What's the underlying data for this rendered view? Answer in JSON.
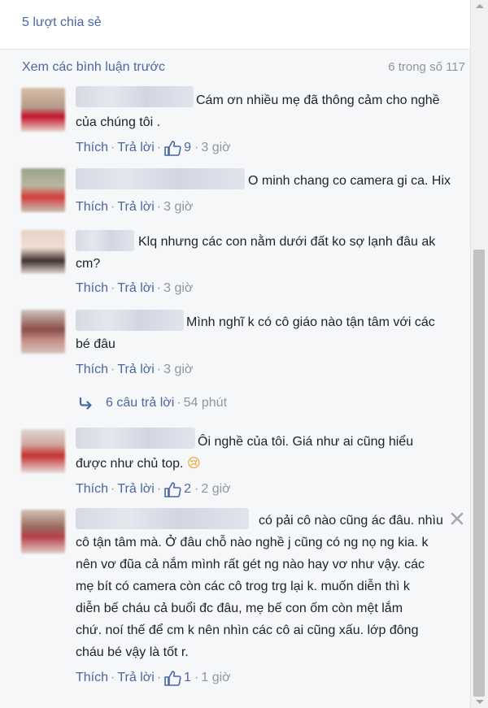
{
  "share": {
    "label": "5 lượt chia sẻ"
  },
  "comments_header": {
    "more_label": "Xem các bình luận trước",
    "count_label": "6 trong số 117"
  },
  "actions": {
    "like_label": "Thích",
    "reply_label": "Trả lời",
    "separator": "·"
  },
  "comments": [
    {
      "lines": [
        "Cám ơn nhiều mẹ đã thông cảm cho nghề",
        "của chúng tôi ."
      ],
      "likes": "9",
      "time": "3 giờ"
    },
    {
      "lines": [
        "O minh chang co camera gi ca. Hix"
      ],
      "likes": "",
      "time": "3 giờ"
    },
    {
      "lines": [
        "Klq nhưng các con nằm dưới đất ko sợ lạnh đâu ak",
        "cm?"
      ],
      "likes": "",
      "time": "3 giờ"
    },
    {
      "lines": [
        "Mình nghĩ k có cô giáo nào tận tâm với các",
        "bé đâu"
      ],
      "likes": "",
      "time": "3 giờ",
      "replies": {
        "label": "6 câu trả lời",
        "time": "54 phút"
      }
    },
    {
      "lines": [
        "Ôi nghề của tôi. Giá như ai cũng hiểu",
        "được như chủ top."
      ],
      "emoji": "😢",
      "likes": "2",
      "time": "2 giờ"
    },
    {
      "lines": [
        "có pải cô nào cũng ác đâu. nhìu",
        "cô tận tâm mà. Ở đâu chỗ nào nghề j cũng có ng nọ ng kia. k",
        "nên vơ đũa cả nắm mình rất gét ng nào hay vơ như vậy. các",
        "mẹ bít có camera còn các cô trog trg lại k. muốn diễn thì k",
        "diễn bế cháu cả buổi đc đâu, mẹ bế con ốm còn mệt lắm",
        "chứ. noí thế để cm k nên nhìn các cô ai cũng xấu. lớp đông",
        "cháu bé vậy là tốt r."
      ],
      "likes": "1",
      "time": "1 giờ"
    }
  ],
  "icons": {
    "like": "thumbs-up-icon",
    "reply_arrow": "reply-arrow-icon",
    "close": "close-icon"
  },
  "colors": {
    "link": "#4b67a1",
    "meta": "#90949c",
    "text": "#1d2129",
    "background": "#f6f7f9"
  }
}
